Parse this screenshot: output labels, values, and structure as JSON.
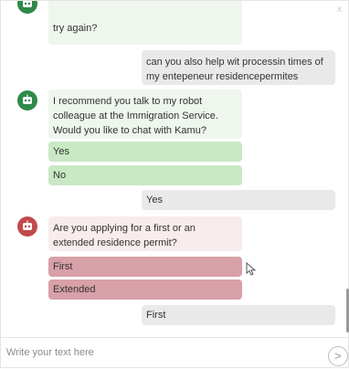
{
  "window": {
    "close_label": "x"
  },
  "messages": [
    {
      "sender": "bot",
      "theme": "green",
      "text": "try again?"
    },
    {
      "sender": "user",
      "text": "can you also help wit processin times of my entepeneur residencepermites"
    },
    {
      "sender": "bot",
      "theme": "green",
      "text": "I recommend you talk to my robot colleague at the Immigration Service. Would you like to chat with Kamu?"
    },
    {
      "sender": "user",
      "text": "Yes"
    },
    {
      "sender": "bot",
      "theme": "red",
      "text": "Are you applying for a first or an extended residence permit?"
    },
    {
      "sender": "user",
      "text": "First"
    }
  ],
  "options_green": [
    "Yes",
    "No"
  ],
  "options_red": [
    "First",
    "Extended"
  ],
  "composer": {
    "placeholder": "Write your text here",
    "value": ""
  },
  "colors": {
    "bot_green_avatar": "#2f8a4a",
    "bot_red_avatar": "#c24a4a",
    "option_green": "#c9e8c4",
    "option_red": "#d8a0a8",
    "user_bubble": "#e9e9e9"
  },
  "icons": {
    "bot_avatar": "robot-icon",
    "send": "send-arrow-icon"
  }
}
